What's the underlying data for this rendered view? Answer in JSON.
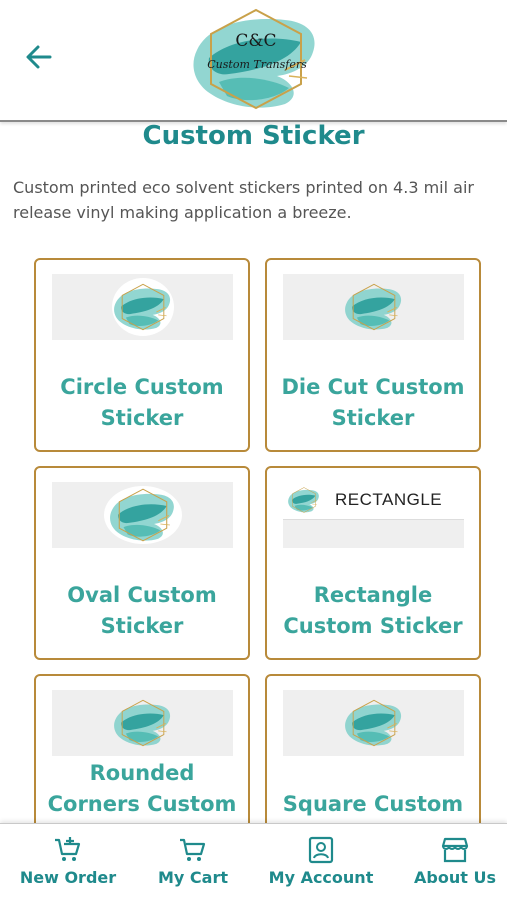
{
  "header": {
    "back_icon": "arrow-left-icon",
    "logo": {
      "monogram": "C&C",
      "script": "Custom Transfers"
    }
  },
  "page": {
    "title": "Custom Sticker",
    "description": "Custom printed eco solvent stickers printed on 4.3 mil air release vinyl making application a breeze."
  },
  "products": [
    {
      "label": "Circle Custom Sticker"
    },
    {
      "label": "Die Cut Custom Sticker"
    },
    {
      "label": "Oval Custom Sticker"
    },
    {
      "label": "Rectangle Custom Sticker",
      "thumb_text": "RECTANGLE"
    },
    {
      "label": "Rounded Corners Custom Sticker"
    },
    {
      "label": "Square Custom Sticker"
    }
  ],
  "bottom_nav": [
    {
      "label": "New Order",
      "icon": "cart-plus-icon"
    },
    {
      "label": "My Cart",
      "icon": "cart-icon"
    },
    {
      "label": "My Account",
      "icon": "account-icon"
    },
    {
      "label": "About Us",
      "icon": "store-icon"
    }
  ],
  "colors": {
    "accent": "#1f8a8c",
    "card_label": "#3aa59c",
    "card_border": "#b88a3a",
    "description": "#555555"
  }
}
